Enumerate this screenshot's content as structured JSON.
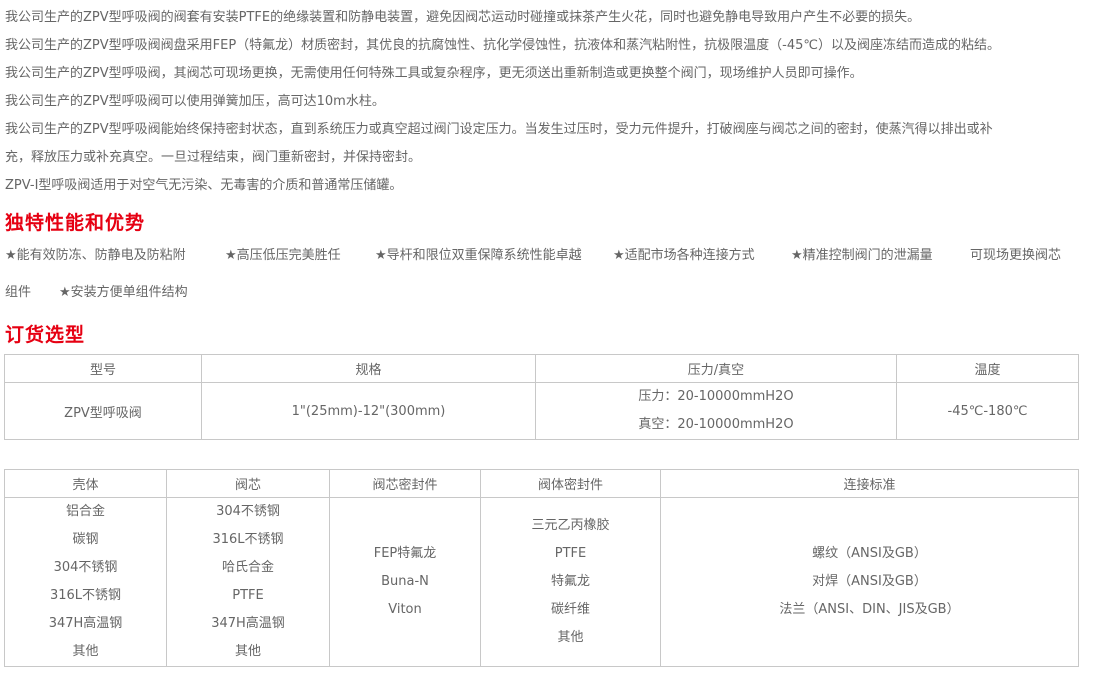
{
  "intro": [
    "我公司生产的ZPV型呼吸阀的阀套有安装PTFE的绝缘装置和防静电装置，避免因阀芯运动时碰撞或抹茶产生火花，同时也避免静电导致用户产生不必要的损失。",
    "我公司生产的ZPV型呼吸阀阀盘采用FEP（特氟龙）材质密封，其优良的抗腐蚀性、抗化学侵蚀性，抗液体和蒸汽粘附性，抗极限温度（-45℃）以及阀座冻结而造成的粘结。",
    "我公司生产的ZPV型呼吸阀，其阀芯可现场更换，无需使用任何特殊工具或复杂程序，更无须送出重新制造或更换整个阀门，现场维护人员即可操作。",
    "我公司生产的ZPV型呼吸阀可以使用弹簧加压，高可达10m水柱。",
    "我公司生产的ZPV型呼吸阀能始终保持密封状态，直到系统压力或真空超过阀门设定压力。当发生过压时，受力元件提升，打破阀座与阀芯之间的密封，使蒸汽得以排出或补",
    "充，释放压力或补充真空。一旦过程结束，阀门重新密封，并保持密封。",
    "ZPV-I型呼吸阀适用于对空气无污染、无毒害的介质和普通常压储罐。"
  ],
  "features_heading": "独特性能和优势",
  "features": {
    "line1": [
      "★能有效防冻、防静电及防粘附",
      "★高压低压完美胜任",
      "★导杆和限位双重保障系统性能卓越",
      "★适配市场各种连接方式",
      "★精准控制阀门的泄漏量",
      "可现场更换阀芯"
    ],
    "line2": [
      "组件",
      "★安装方便单组件结构"
    ]
  },
  "order_heading": "订货选型",
  "table1": {
    "headers": [
      "型号",
      "规格",
      "压力/真空",
      "温度"
    ],
    "model": "ZPV型呼吸阀",
    "spec": "1\"(25mm)-12\"(300mm)",
    "pressure": "压力：20-10000mmH2O",
    "vacuum": "真空：20-10000mmH2O",
    "temperature": "-45℃-180℃"
  },
  "table2": {
    "headers": [
      "壳体",
      "阀芯",
      "阀芯密封件",
      "阀体密封件",
      "连接标准"
    ],
    "shell": [
      "铝合金",
      "碳钢",
      "304不锈钢",
      "316L不锈钢",
      "347H高温钢",
      "其他"
    ],
    "core": [
      "304不锈钢",
      "316L不锈钢",
      "哈氏合金",
      "PTFE",
      "347H高温钢",
      "其他"
    ],
    "core_seal": [
      "FEP特氟龙",
      "Buna-N",
      "Viton"
    ],
    "body_seal": [
      "三元乙丙橡胶",
      "PTFE",
      "特氟龙",
      "碳纤维",
      "其他"
    ],
    "connection": [
      "螺纹（ANSI及GB）",
      "对焊（ANSI及GB）",
      "法兰（ANSI、DIN、JIS及GB）"
    ]
  }
}
